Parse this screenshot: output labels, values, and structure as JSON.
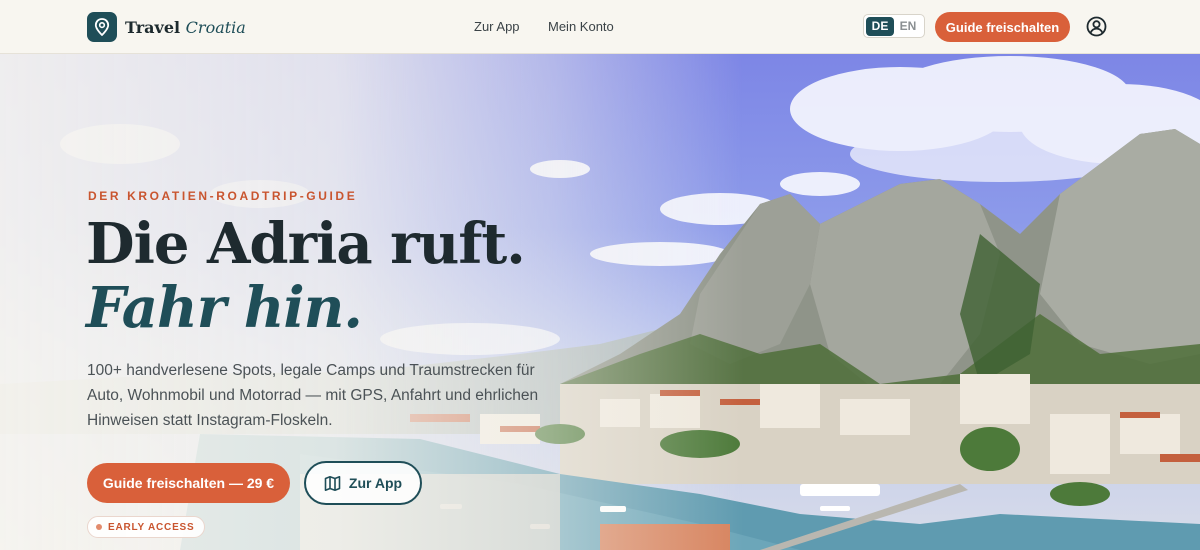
{
  "nav": {
    "brand_prefix": "Travel",
    "brand_accent": "Croatia",
    "links": [
      "Zur App",
      "Mein Konto"
    ],
    "languages": [
      "DE",
      "EN"
    ],
    "active_language": "DE",
    "cta_label": "Guide freischalten"
  },
  "hero": {
    "eyebrow": "DER KROATIEN-ROADTRIP-GUIDE",
    "headline_line1": "Die Adria ruft.",
    "headline_line2": "Fahr hin.",
    "lead": "100+ handverlesene Spots, legale Camps und Traumstrecken für Auto, Wohnmobil und Motorrad — mit GPS, Anfahrt und ehrlichen Hinweisen statt Instagram-Floskeln.",
    "primary_cta": "Guide freischalten — 29 €",
    "secondary_cta": "Zur App",
    "badge": "EARLY ACCESS"
  },
  "colors": {
    "brand": "#1f4e58",
    "accent": "#d9603a"
  },
  "icons": {
    "logo": "map-pin-icon",
    "account": "user-circle-icon",
    "secondary_cta": "map-icon"
  }
}
